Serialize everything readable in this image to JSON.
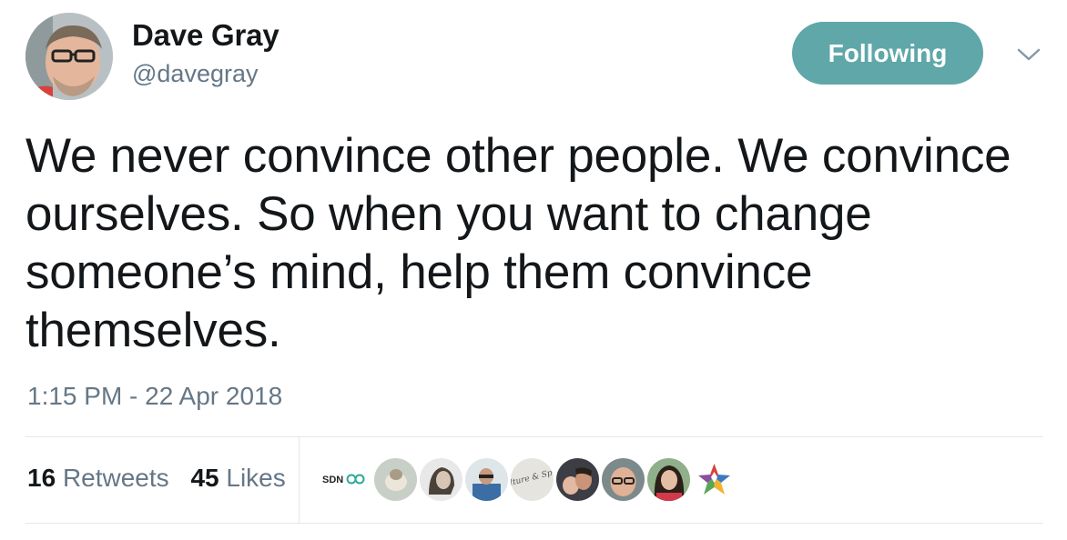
{
  "author": {
    "name": "Dave Gray",
    "handle": "@davegray"
  },
  "follow_button": {
    "label": "Following"
  },
  "tweet": {
    "text": "We never convince other people. We convince ourselves. So when you want to change someone’s mind, help them convince themselves.",
    "timestamp": "1:15 PM - 22 Apr 2018"
  },
  "stats": {
    "retweets_count": "16",
    "retweets_label": "Retweets",
    "likes_count": "45",
    "likes_label": "Likes"
  },
  "likers": {
    "logo_sdn": "SDN",
    "logo_culture": "Culture & Spirit"
  },
  "colors": {
    "follow_button": "#5fa7a8",
    "secondary_text": "#657786",
    "primary_text": "#14171a",
    "divider": "#e1e8ed"
  },
  "icons": [
    "avatar-photo",
    "chevron-down-icon",
    "liker-avatar",
    "star-logo-icon"
  ]
}
